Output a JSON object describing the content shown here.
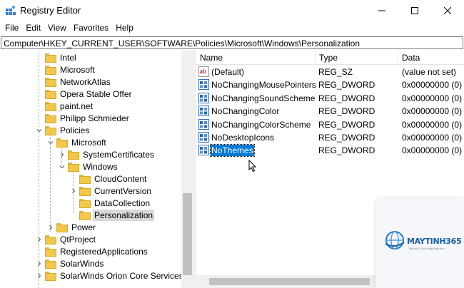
{
  "window": {
    "title": "Registry Editor"
  },
  "menu": [
    "File",
    "Edit",
    "View",
    "Favorites",
    "Help"
  ],
  "address": "Computer\\HKEY_CURRENT_USER\\SOFTWARE\\Policies\\Microsoft\\Windows\\Personalization",
  "tree": [
    {
      "label": "Intel",
      "expander": "none"
    },
    {
      "label": "Microsoft",
      "expander": "none"
    },
    {
      "label": "NetworkAtlas",
      "expander": "none"
    },
    {
      "label": "Opera Stable Offer",
      "expander": "none"
    },
    {
      "label": "paint.net",
      "expander": "none"
    },
    {
      "label": "Philipp Schmieder",
      "expander": "none"
    },
    {
      "label": "Policies",
      "expander": "expanded"
    },
    {
      "label": "Microsoft",
      "expander": "expanded"
    },
    {
      "label": "SystemCertificates",
      "expander": "collapsed"
    },
    {
      "label": "Windows",
      "expander": "expanded"
    },
    {
      "label": "CloudContent",
      "expander": "none"
    },
    {
      "label": "CurrentVersion",
      "expander": "collapsed"
    },
    {
      "label": "DataCollection",
      "expander": "none"
    },
    {
      "label": "Personalization",
      "expander": "none",
      "selected": true
    },
    {
      "label": "Power",
      "expander": "collapsed"
    },
    {
      "label": "QtProject",
      "expander": "collapsed"
    },
    {
      "label": "RegisteredApplications",
      "expander": "none"
    },
    {
      "label": "SolarWinds",
      "expander": "collapsed"
    },
    {
      "label": "SolarWinds Orion Core Services",
      "expander": "collapsed"
    }
  ],
  "columns": {
    "name": "Name",
    "type": "Type",
    "data": "Data"
  },
  "values": [
    {
      "name": "(Default)",
      "type": "REG_SZ",
      "data": "(value not set)",
      "icon": "string-value-icon"
    },
    {
      "name": "NoChangingMousePointers",
      "type": "REG_DWORD",
      "data": "0x00000000 (0)",
      "icon": "dword-value-icon"
    },
    {
      "name": "NoChangingSoundScheme",
      "type": "REG_DWORD",
      "data": "0x00000000 (0)",
      "icon": "dword-value-icon"
    },
    {
      "name": "NoChangingColor",
      "type": "REG_DWORD",
      "data": "0x00000000 (0)",
      "icon": "dword-value-icon"
    },
    {
      "name": "NoChangingColorScheme",
      "type": "REG_DWORD",
      "data": "0x00000000 (0)",
      "icon": "dword-value-icon"
    },
    {
      "name": "NoDesktopIcons",
      "type": "REG_DWORD",
      "data": "0x00000000 (0)",
      "icon": "dword-value-icon"
    },
    {
      "name": "NoThemes",
      "type": "REG_DWORD",
      "data": "0x00000000 (0)",
      "icon": "dword-value-icon",
      "selected": true
    }
  ],
  "watermark": {
    "brand": "MAYTINH365",
    "tagline": "Chia sẻ & Thủ thuật Máy tính"
  },
  "colors": {
    "selection": "#0078d7",
    "folder": "#f3c849",
    "tree_selection": "#d9d9d9"
  }
}
